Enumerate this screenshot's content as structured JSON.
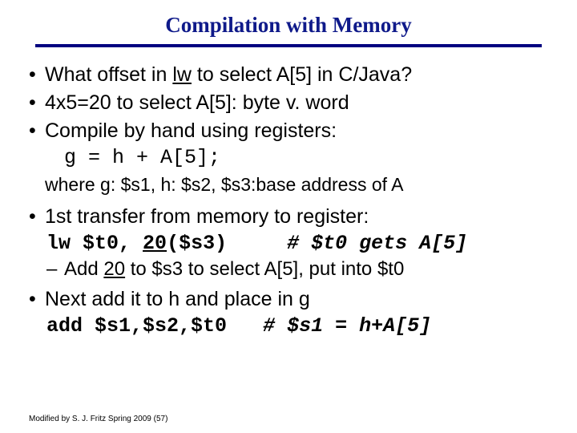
{
  "title": "Compilation with Memory",
  "bullets": {
    "b1_pre": "What offset in ",
    "b1_lw": "lw",
    "b1_post": " to select A[5] in C/Java?",
    "b2": " 4x5=20 to select A[5]: byte v. word",
    "b3": "Compile by hand using registers:",
    "code1": "g = h + A[5];",
    "where": "where g: $s1, h: $s2, $s3:base address of A",
    "b4": "1st transfer from memory to register:",
    "lw_line_a": "lw $t0,",
    "lw_line_b": "20",
    "lw_line_c": "($s3)",
    "lw_comment": "# $t0 gets A[5]",
    "sub1_a": "Add ",
    "sub1_b": "20",
    "sub1_c": " to $s3 to select A[5], put into $t0",
    "b5": "Next add it to h and place in g",
    "add_line": "add $s1,$s2,$t0",
    "add_comment": "# $s1 = h+A[5]"
  },
  "footer": "Modified by S. J. Fritz  Spring 2009 (57)"
}
